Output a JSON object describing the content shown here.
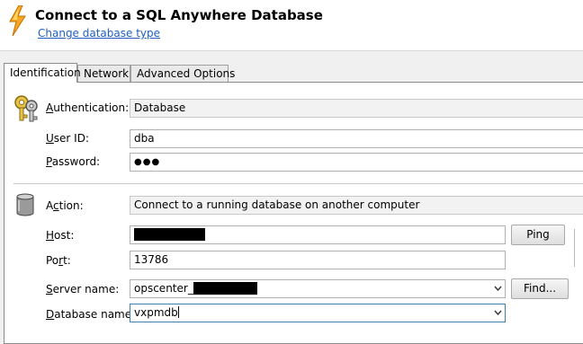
{
  "header": {
    "title": "Connect to a SQL Anywhere Database",
    "change_link": "Change database type"
  },
  "tabs": [
    {
      "label": "Identification",
      "active": true
    },
    {
      "label": "Network",
      "active": false
    },
    {
      "label": "Advanced Options",
      "active": false
    }
  ],
  "identification": {
    "authentication": {
      "label_hot": "A",
      "label_rest": "uthentication:",
      "value": "Database"
    },
    "user_id": {
      "label_hot": "U",
      "label_rest": "ser ID:",
      "value": "dba"
    },
    "password": {
      "label_hot": "P",
      "label_rest": "assword:",
      "value": "●●●"
    }
  },
  "connection": {
    "action": {
      "label_pre": "A",
      "label_hot": "c",
      "label_rest": "tion:",
      "value": "Connect to a running database on another computer"
    },
    "host": {
      "label_hot": "H",
      "label_rest": "ost:",
      "value": ""
    },
    "port": {
      "label_pre": "Po",
      "label_hot": "r",
      "label_rest": "t:",
      "value": "13786"
    },
    "server_name": {
      "label_pre": "",
      "label_hot": "S",
      "label_rest": "erver name:",
      "value": "opscenter_"
    },
    "database_name": {
      "label_hot": "D",
      "label_rest": "atabase name:",
      "value": "vxpmdb"
    }
  },
  "buttons": {
    "ping": "Ping",
    "find": "Find..."
  },
  "colors": {
    "link": "#1f5fbf",
    "redaction": "#000000"
  },
  "icons": {
    "app": "lightning-bolt-icon",
    "keys": "keys-icon",
    "database": "database-cylinder-icon",
    "dropdown": "chevron-down-icon"
  }
}
